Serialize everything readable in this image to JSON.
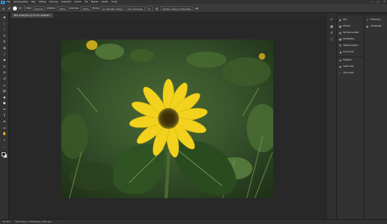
{
  "app": {
    "logo": "Ps"
  },
  "menubar": {
    "items": [
      "Fájl",
      "Szerkesztés",
      "Kép",
      "Réteg",
      "Szöveg",
      "Kijelölés",
      "Szűrő",
      "3D",
      "Nézet",
      "Ablak",
      "Súgó"
    ]
  },
  "window_controls": {
    "minimize": "—",
    "maximize": "□",
    "close": "✕"
  },
  "options_bar": {
    "brush_size": "40",
    "mode_label": "Mód:",
    "mode_value": "Normál",
    "opacity_label": "Átlátsz.:",
    "opacity_value": "100%",
    "flow_label": "Áramlás:",
    "flow_value": "100%",
    "sample_label": "Minta:",
    "sample_value": "Az aktuális réteg",
    "diffusion_value": "Szín keverése",
    "angle_value": "0°",
    "pressure_label": "Nyomás",
    "dock_label": "Összes réteg mintavétele"
  },
  "document": {
    "tab_title": "IMG 9160.JPG @ 33,3% (RGB/8*)"
  },
  "tools": [
    {
      "name": "move-icon",
      "glyph": "✥"
    },
    {
      "name": "marquee-icon",
      "glyph": "⬚"
    },
    {
      "name": "lasso-icon",
      "glyph": "◌"
    },
    {
      "name": "quick-select-icon",
      "glyph": "✎"
    },
    {
      "name": "crop-icon",
      "glyph": "⌗"
    },
    {
      "name": "frame-icon",
      "glyph": "⊠"
    },
    {
      "name": "eyedropper-icon",
      "glyph": "⁄"
    },
    {
      "name": "healing-icon",
      "glyph": "✚"
    },
    {
      "name": "brush-icon",
      "glyph": "✐"
    },
    {
      "name": "stamp-icon",
      "glyph": "⛁"
    },
    {
      "name": "history-brush-icon",
      "glyph": "↺"
    },
    {
      "name": "eraser-icon",
      "glyph": "▱"
    },
    {
      "name": "gradient-icon",
      "glyph": "▤"
    },
    {
      "name": "blur-icon",
      "glyph": "◆"
    },
    {
      "name": "dodge-icon",
      "glyph": "●"
    },
    {
      "name": "pen-icon",
      "glyph": "✒"
    },
    {
      "name": "type-icon",
      "glyph": "T"
    },
    {
      "name": "path-select-icon",
      "glyph": "➤"
    },
    {
      "name": "shape-icon",
      "glyph": "▭"
    },
    {
      "name": "hand-icon",
      "glyph": "✋"
    },
    {
      "name": "zoom-icon",
      "glyph": "⌕"
    },
    {
      "name": "more-tools-icon",
      "glyph": "…"
    }
  ],
  "panels": {
    "group1": [
      {
        "icon": "color-icon",
        "glyph": "◐",
        "label": "Szín"
      },
      {
        "icon": "swatches-icon",
        "glyph": "▦",
        "label": "Minták"
      },
      {
        "icon": "gradients-icon",
        "glyph": "▥",
        "label": "Színátmenetek"
      },
      {
        "icon": "patterns-icon",
        "glyph": "▩",
        "label": "Mintázatok"
      }
    ],
    "group2": [
      {
        "icon": "properties-icon",
        "glyph": "☰",
        "label": "Tulajdonságok"
      },
      {
        "icon": "adjustments-icon",
        "glyph": "◑",
        "label": "Korrekciók"
      }
    ],
    "group3": [
      {
        "icon": "layers-icon",
        "glyph": "◈",
        "label": "Rétegek"
      },
      {
        "icon": "channels-icon",
        "glyph": "◍",
        "label": "Csatornák"
      },
      {
        "icon": "paths-icon",
        "glyph": "⌁",
        "label": "Útvonalak"
      }
    ],
    "right": [
      {
        "icon": "history-icon",
        "glyph": "↶",
        "label": "Előzmény"
      },
      {
        "icon": "actions-icon",
        "glyph": "▶",
        "label": "Műveletek"
      }
    ]
  },
  "status": {
    "zoom": "33,33%",
    "doc_info": "5472 képp. x 3648 képp. (240 ppi)"
  },
  "colors": {
    "foreground": "#000000",
    "background": "#ffffff",
    "accent": "#31a8ff"
  }
}
